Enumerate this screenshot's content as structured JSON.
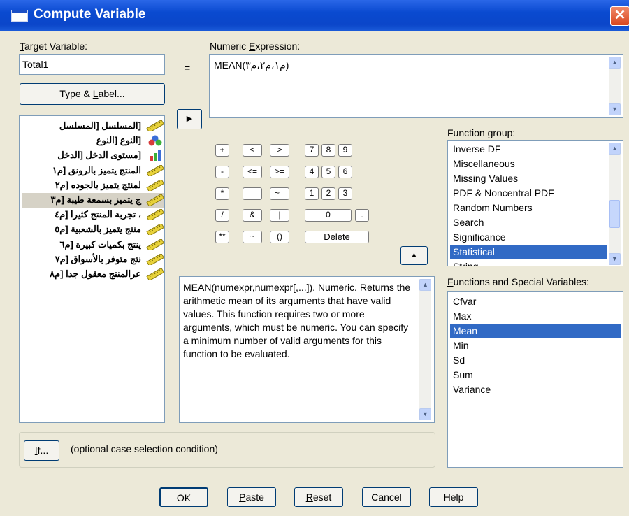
{
  "window": {
    "title": "Compute Variable",
    "close_glyph": "✕"
  },
  "target": {
    "label": "Target Variable:",
    "value": "Total1",
    "equals": "=",
    "type_label_button": "Type & Label..."
  },
  "expression": {
    "label": "Numeric Expression:",
    "value": "MEAN(م١،م٢،م٣)"
  },
  "variables": [
    {
      "label": "[المسلسل [المسلسل",
      "icon": "scale-ruler-icon"
    },
    {
      "label": "[النوع [النوع",
      "icon": "nominal-balls-icon"
    },
    {
      "label": "[مستوى الدخل [الدخل",
      "icon": "ordinal-bars-icon"
    },
    {
      "label": "المنتج يتميز بالرونق [م١",
      "icon": "scale-ruler-icon"
    },
    {
      "label": "لمنتج يتميز بالجوده [م٢",
      "icon": "scale-ruler-icon"
    },
    {
      "label": "ج يتميز بسمعة طيبة [م٣",
      "icon": "scale-ruler-icon",
      "selected": true
    },
    {
      "label": "، تجربة المنتج كثيرا [م٤",
      "icon": "scale-ruler-icon"
    },
    {
      "label": "منتج يتميز بالشعبية [م٥",
      "icon": "scale-ruler-icon"
    },
    {
      "label": "ينتج بكميات كبيرة [م٦",
      "icon": "scale-ruler-icon"
    },
    {
      "label": "نتج متوفر بالأسواق [م٧",
      "icon": "scale-ruler-icon"
    },
    {
      "label": "عرالمنتج معقول جدا [م٨",
      "icon": "scale-ruler-icon"
    }
  ],
  "calculator": {
    "rows": [
      [
        "+",
        "<",
        ">",
        "7",
        "8",
        "9"
      ],
      [
        "-",
        "<=",
        ">=",
        "4",
        "5",
        "6"
      ],
      [
        "*",
        "=",
        "~=",
        "1",
        "2",
        "3"
      ],
      [
        "/",
        "&",
        "|",
        "0",
        "."
      ],
      [
        "**",
        "~",
        "()",
        "Delete"
      ]
    ]
  },
  "description": "MEAN(numexpr,numexpr[,...]). Numeric. Returns the arithmetic mean of its arguments that have valid values. This function requires two or more arguments, which must be numeric. You can specify a minimum number of valid arguments for this function to be evaluated.",
  "function_group": {
    "label": "Function group:",
    "items": [
      "Inverse DF",
      "Miscellaneous",
      "Missing Values",
      "PDF & Noncentral PDF",
      "Random Numbers",
      "Search",
      "Significance",
      "Statistical",
      "String"
    ],
    "selected": "Statistical"
  },
  "functions": {
    "label": "Functions and Special Variables:",
    "items": [
      "Cfvar",
      "Max",
      "Mean",
      "Min",
      "Sd",
      "Sum",
      "Variance"
    ],
    "selected": "Mean"
  },
  "if_section": {
    "button": "If...",
    "text": "(optional case selection condition)"
  },
  "buttons": {
    "ok": "OK",
    "paste": "Paste",
    "reset": "Reset",
    "cancel": "Cancel",
    "help": "Help"
  },
  "colors": {
    "titlebar": "#0b46c9",
    "selection": "#316ac5",
    "face": "#ece9d8"
  }
}
